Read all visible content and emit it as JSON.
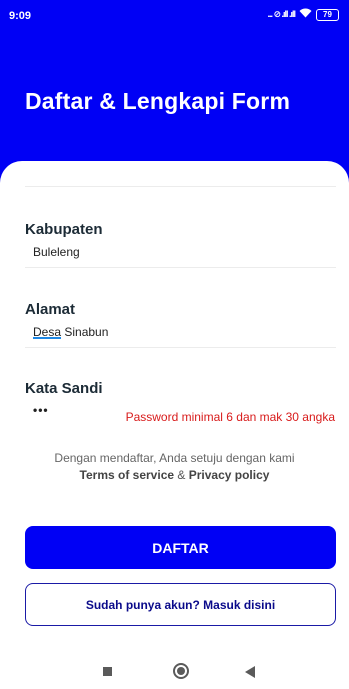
{
  "status_bar": {
    "time": "9:09",
    "icons": "... ⊘ .ıll .ıll",
    "battery": "79"
  },
  "header": {
    "title": "Daftar & Lengkapi Form"
  },
  "form": {
    "kabupaten": {
      "label": "Kabupaten",
      "value": "Buleleng"
    },
    "alamat": {
      "label": "Alamat",
      "value_underlined": "Desa",
      "value_rest": " Sinabun"
    },
    "kata_sandi": {
      "label": "Kata Sandi",
      "value": "•••",
      "error": "Password minimal 6 dan mak 30 angka"
    }
  },
  "terms": {
    "line1": "Dengan mendaftar, Anda setuju dengan kami",
    "terms_link": "Terms of service",
    "separator": " & ",
    "privacy_link": "Privacy policy"
  },
  "buttons": {
    "daftar": "DAFTAR",
    "login": "Sudah punya akun? Masuk disini"
  },
  "colors": {
    "primary": "#0000f5",
    "error": "#d81b1b"
  }
}
